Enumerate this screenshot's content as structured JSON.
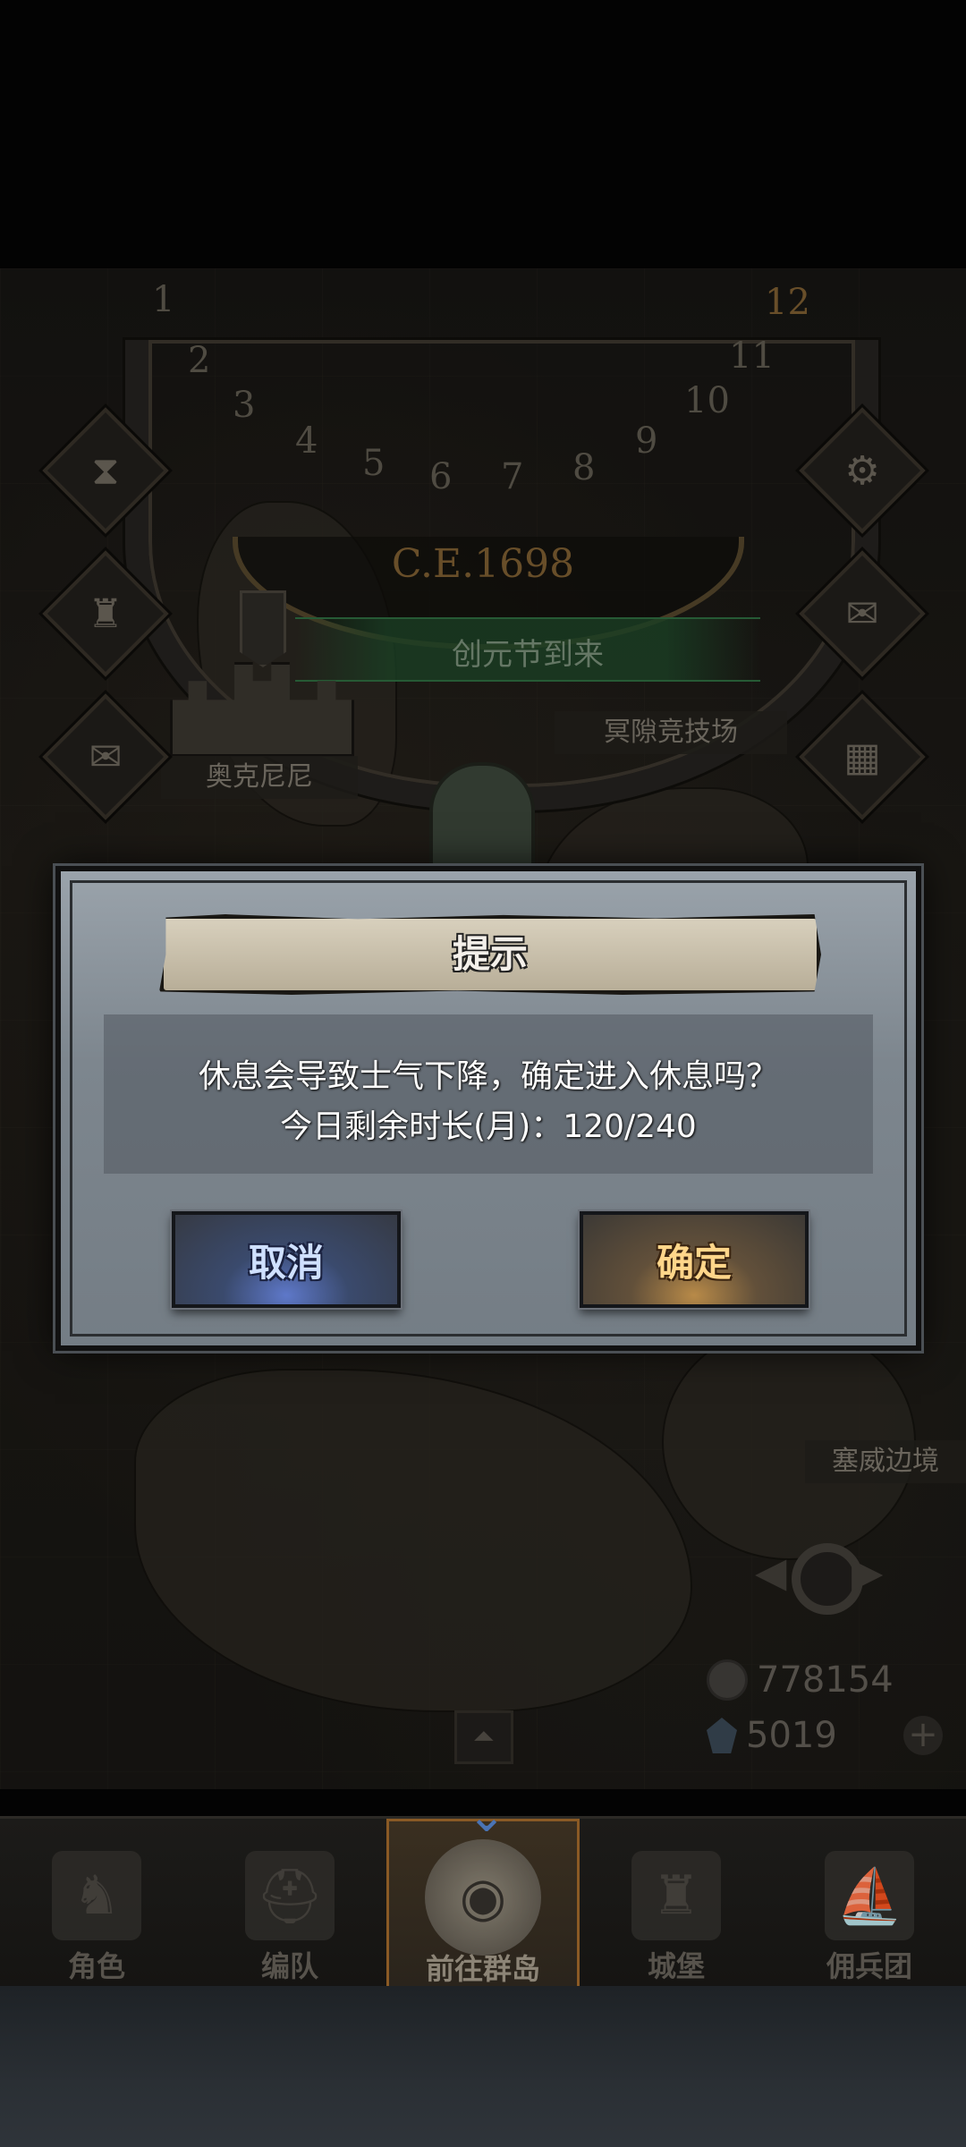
{
  "map": {
    "year": "C.E.1698",
    "months": [
      "1",
      "2",
      "3",
      "4",
      "5",
      "6",
      "7",
      "8",
      "9",
      "10",
      "11",
      "12"
    ],
    "event_banner": "创元节到来",
    "places": [
      {
        "name": "奥克尼尼"
      },
      {
        "name": "冥隙竞技场"
      },
      {
        "name": "塞威边境"
      }
    ],
    "side_icons_left": [
      "hourglass-icon",
      "money-bag-icon",
      "scroll-icon"
    ],
    "side_icons_right": [
      "gear-icon",
      "mail-icon",
      "grid-icon"
    ]
  },
  "currency": {
    "silver": "778154",
    "gems": "5019"
  },
  "dialog": {
    "title": "提示",
    "message_line1": "休息会导致士气下降，确定进入休息吗？",
    "message_line2": "今日剩余时长(月)：120/240",
    "cancel_label": "取消",
    "confirm_label": "确定"
  },
  "bottom_nav": {
    "items": [
      {
        "label": "角色",
        "icon": "knight-icon"
      },
      {
        "label": "编队",
        "icon": "helmet-icon"
      },
      {
        "label": "前往群岛",
        "icon": "globe-icon",
        "active": true
      },
      {
        "label": "城堡",
        "icon": "castle-icon"
      },
      {
        "label": "佣兵团",
        "icon": "ship-icon"
      }
    ]
  },
  "colors": {
    "cancel_accent": "#5e78c9",
    "confirm_accent": "#b88a48",
    "active_tab_border": "#8a5a25",
    "event_green": "#3b8a52"
  }
}
